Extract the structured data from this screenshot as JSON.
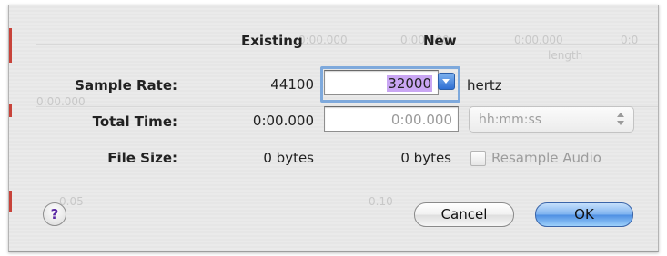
{
  "headers": {
    "existing": "Existing",
    "new": "New"
  },
  "rows": {
    "sample_rate": {
      "label": "Sample Rate:",
      "existing": "44100",
      "new": "32000",
      "unit": "hertz"
    },
    "total_time": {
      "label": "Total Time:",
      "existing": "0:00.000",
      "new": "0:00.000",
      "format": "hh:mm:ss"
    },
    "file_size": {
      "label": "File Size:",
      "existing": "0 bytes",
      "new": "0 bytes"
    }
  },
  "resample_label": "Resample Audio",
  "buttons": {
    "cancel": "Cancel",
    "ok": "OK",
    "help": "?"
  },
  "background": {
    "time_a": "0:00.000",
    "time_b": "0:00.000",
    "time_c": "0:00.000",
    "time_d": "0:0",
    "word_a": "length",
    "tick_a": "0.05",
    "tick_b": "0.10"
  },
  "colors": {
    "selection": "#c9a6f3",
    "focus_ring": "#7ea9dc",
    "default_button": "#4e8fe3"
  },
  "icons": {
    "help": "question-mark-icon",
    "dropdown": "chevron-down-icon",
    "stepper": "up-down-arrows-icon"
  }
}
